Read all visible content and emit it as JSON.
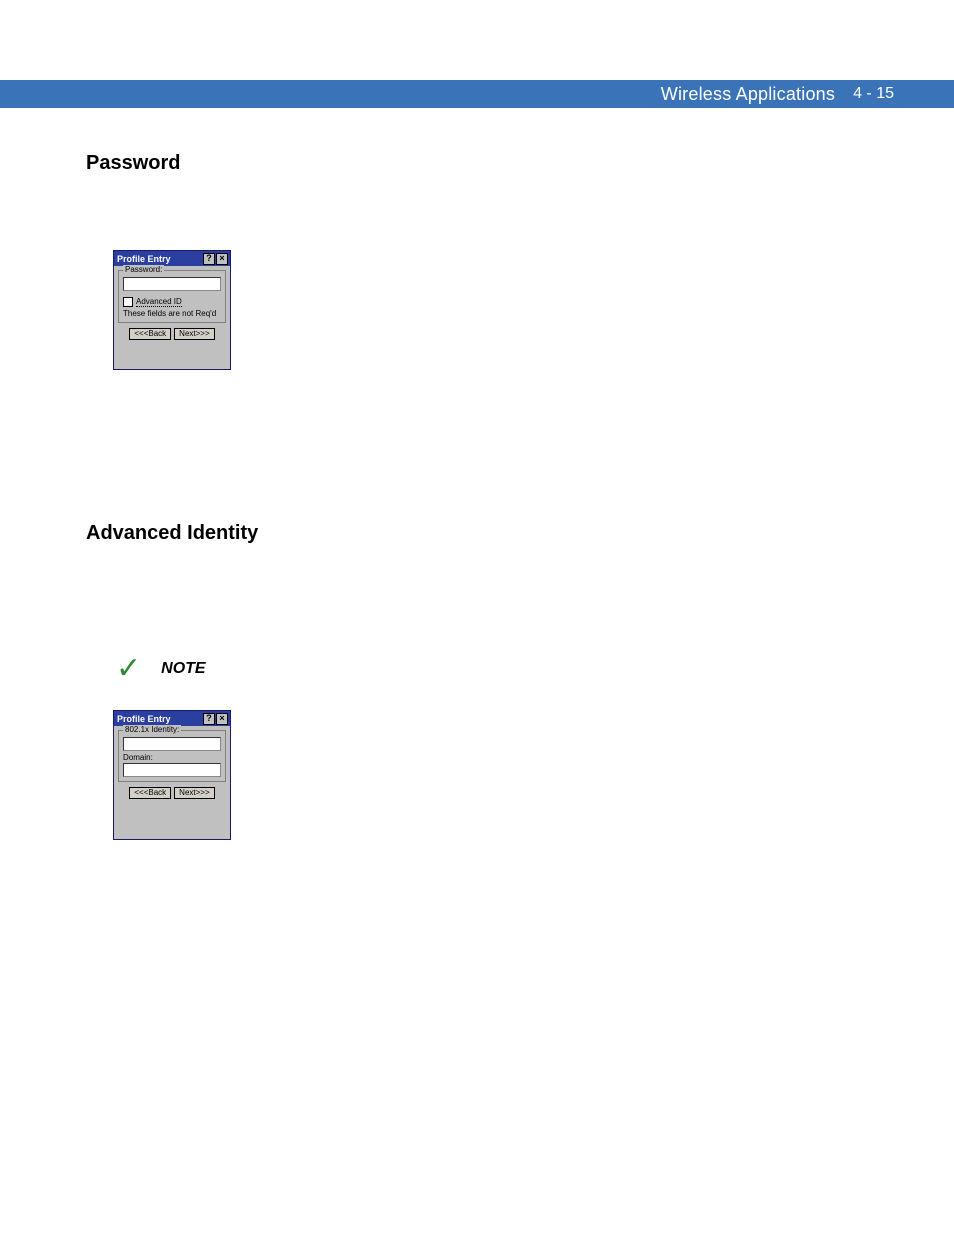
{
  "header": {
    "title": "Wireless Applications",
    "pagenum": "4 - 15"
  },
  "sections": {
    "password_heading": "Password",
    "advanced_heading": "Advanced Identity"
  },
  "note": {
    "label": "NOTE"
  },
  "dialog_pw": {
    "title": "Profile Entry",
    "help": "?",
    "close": "×",
    "group_label": "Password:",
    "input_value": "",
    "advanced_id": "Advanced ID",
    "status": "These fields are not Req'd",
    "back": "<<<Back",
    "next": "Next>>>"
  },
  "dialog_adv": {
    "title": "Profile Entry",
    "help": "?",
    "close": "×",
    "group_label": "802.1x Identity:",
    "identity_value": "",
    "domain_label": "Domain:",
    "domain_value": "",
    "back": "<<<Back",
    "next": "Next>>>"
  }
}
